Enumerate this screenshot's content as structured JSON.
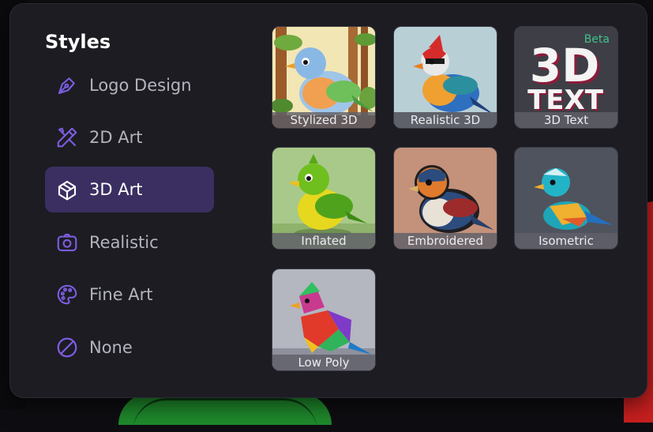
{
  "panel": {
    "title": "Styles"
  },
  "menu": [
    {
      "label": "Logo Design",
      "icon": "pen-nib-icon",
      "active": false
    },
    {
      "label": "2D Art",
      "icon": "pencil-ruler-icon",
      "active": false
    },
    {
      "label": "3D Art",
      "icon": "cube-icon",
      "active": true
    },
    {
      "label": "Realistic",
      "icon": "camera-icon",
      "active": false
    },
    {
      "label": "Fine Art",
      "icon": "palette-icon",
      "active": false
    },
    {
      "label": "None",
      "icon": "slash-circle-icon",
      "active": false
    }
  ],
  "styles": [
    {
      "label": "Stylized 3D",
      "badge": ""
    },
    {
      "label": "Realistic 3D",
      "badge": ""
    },
    {
      "label": "3D Text",
      "badge": "Beta",
      "art_text_top": "3D",
      "art_text_bottom": "TEXT"
    },
    {
      "label": "Inflated",
      "badge": ""
    },
    {
      "label": "Embroidered",
      "badge": ""
    },
    {
      "label": "Isometric",
      "badge": ""
    },
    {
      "label": "Low Poly",
      "badge": ""
    }
  ],
  "colors": {
    "accent": "#7c5ce0",
    "active_bg": "#3b2f62",
    "beta": "#3fc28a",
    "panel": "#1c1c22"
  }
}
